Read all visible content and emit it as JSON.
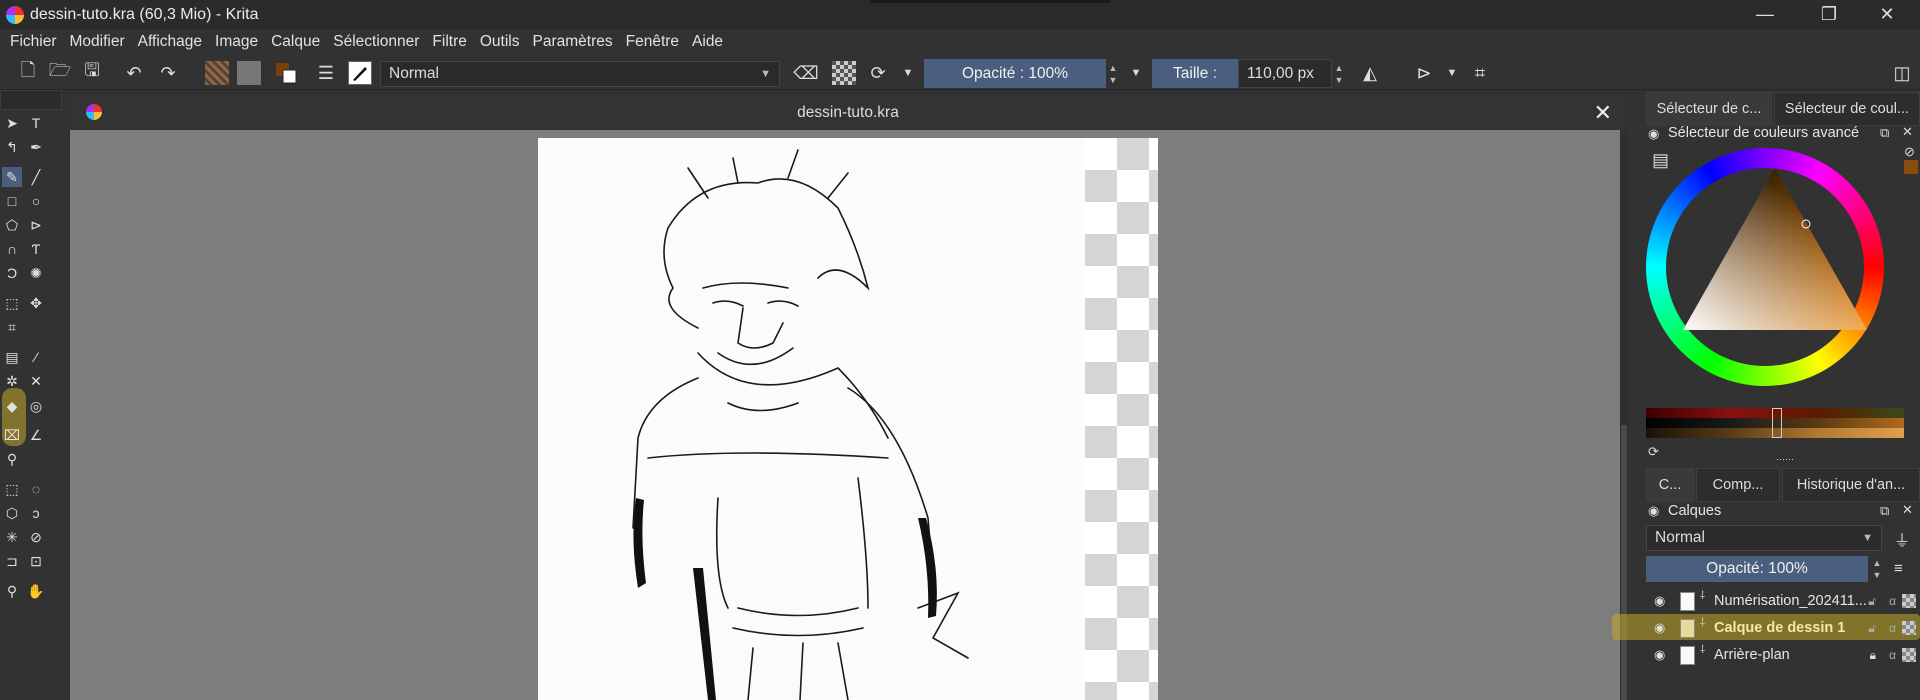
{
  "window": {
    "title": "dessin-tuto.kra (60,3 Mio)  - Krita",
    "minimize": "—",
    "maximize": "❐",
    "close": "✕"
  },
  "menu": [
    "Fichier",
    "Modifier",
    "Affichage",
    "Image",
    "Calque",
    "Sélectionner",
    "Filtre",
    "Outils",
    "Paramètres",
    "Fenêtre",
    "Aide"
  ],
  "toolbar": {
    "blend_mode": "Normal",
    "opacity_label": "Opacité : 100%",
    "opacity_value": 100,
    "size_label": "Taille :",
    "size_value": "110,00 px"
  },
  "document": {
    "tab_title": "dessin-tuto.kra",
    "close": "✕"
  },
  "dock": {
    "top_tabs": [
      "Sélecteur de c...",
      "Sélecteur de coul..."
    ],
    "color_panel_title": "Sélecteur de couleurs avancé",
    "bottom_tabs": [
      "C...",
      "Comp...",
      "Historique d'an..."
    ],
    "layers_title": "Calques",
    "layers_blend_mode": "Normal",
    "layers_opacity": "Opacité:  100%",
    "layers": [
      {
        "name": "Numérisation_202411...",
        "locked": false,
        "active": false
      },
      {
        "name": "Calque de dessin 1",
        "locked": false,
        "active": true
      },
      {
        "name": "Arrière-plan",
        "locked": true,
        "active": false
      }
    ]
  },
  "colors": {
    "accent": "#4a5f7f",
    "highlight": "#c4aa28",
    "selected_color": "#8a4b0f"
  }
}
